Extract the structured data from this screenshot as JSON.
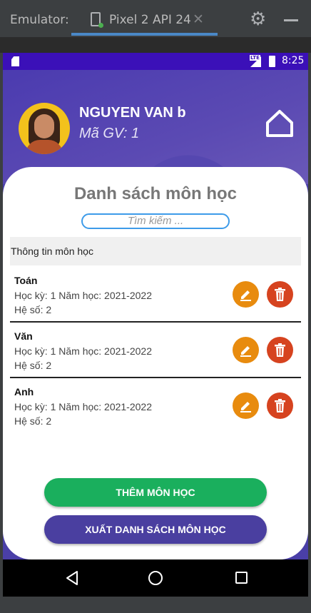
{
  "emulator": {
    "label": "Emulator:",
    "tab_title": "Pixel 2 API 24",
    "close_glyph": "✕",
    "gear_glyph": "⚙"
  },
  "status_bar": {
    "network": "LTE",
    "time": "8:25"
  },
  "profile": {
    "name": "NGUYEN VAN b",
    "teacher_id": "Mã GV: 1"
  },
  "main": {
    "title": "Danh sách môn học",
    "search_placeholder": "Tìm kiếm ...",
    "section_header": "Thông tin môn học",
    "subjects": [
      {
        "name": "Toán",
        "term": "Học kỳ: 1 Năm học: 2021-2022",
        "coefficient": "Hệ số: 2"
      },
      {
        "name": "Văn",
        "term": "Học kỳ: 1 Năm học: 2021-2022",
        "coefficient": "Hệ số: 2"
      },
      {
        "name": "Anh",
        "term": "Học kỳ: 1 Năm học: 2021-2022",
        "coefficient": "Hệ số: 2"
      }
    ],
    "add_button": "THÊM MÔN HỌC",
    "export_button": "XUẤT DANH SÁCH MÔN HỌC"
  },
  "colors": {
    "primary": "#4a3fa8",
    "status_bar": "#3b10b8",
    "edit": "#e88b0e",
    "delete": "#d6431f",
    "add": "#1aaf5d",
    "export": "#4a3fa0",
    "search_border": "#3d9be9"
  },
  "icons": [
    "device-icon",
    "close-icon",
    "gear-icon",
    "minimize-icon",
    "sd-card-icon",
    "signal-icon",
    "battery-icon",
    "home-icon",
    "edit-icon",
    "trash-icon",
    "back-icon",
    "nav-home-icon",
    "recent-apps-icon"
  ]
}
